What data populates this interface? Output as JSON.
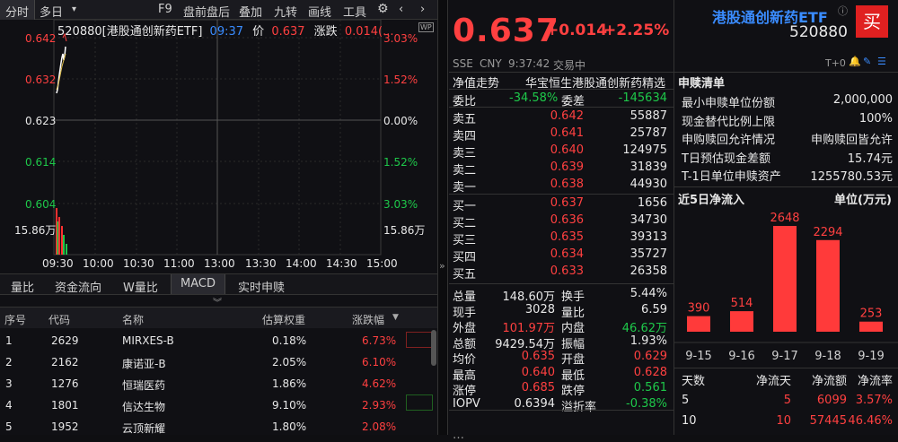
{
  "toolbar": {
    "tabs": [
      "分时",
      "多日"
    ],
    "dropdown": "▾",
    "items": [
      "F9",
      "盘前盘后",
      "叠加",
      "九转",
      "画线",
      "工具"
    ]
  },
  "chart": {
    "code_title": "520880[港股通创新药ETF]",
    "time": "09:37",
    "price_label": "价",
    "price": "0.637",
    "change_label": "涨跌",
    "change": "0.014(...",
    "y_left": [
      "0.642",
      "0.632",
      "0.623",
      "0.614",
      "0.604"
    ],
    "y_right": [
      "3.03%",
      "1.52%",
      "0.00%",
      "1.52%",
      "3.03%"
    ],
    "volume_left": "15.86万",
    "volume_right": "15.86万",
    "x_ticks": [
      "09:30",
      "10:00",
      "10:30",
      "11:00",
      "13:00",
      "13:30",
      "14:00",
      "14:30",
      "15:00"
    ]
  },
  "subtabs": [
    "量比",
    "资金流向",
    "W量比",
    "MACD",
    "实时申赎"
  ],
  "table": {
    "headers": [
      "序号",
      "代码",
      "名称",
      "估算权重",
      "涨跌幅"
    ],
    "rows": [
      {
        "idx": "1",
        "code": "2629",
        "name": "MIRXES-B",
        "weight": "0.18%",
        "chg": "6.73%"
      },
      {
        "idx": "2",
        "code": "2162",
        "name": "康诺亚-B",
        "weight": "2.05%",
        "chg": "6.10%"
      },
      {
        "idx": "3",
        "code": "1276",
        "name": "恒瑞医药",
        "weight": "1.86%",
        "chg": "4.62%"
      },
      {
        "idx": "4",
        "code": "1801",
        "name": "信达生物",
        "weight": "9.10%",
        "chg": "2.93%"
      },
      {
        "idx": "5",
        "code": "1952",
        "name": "云顶新耀",
        "weight": "1.80%",
        "chg": "2.08%"
      }
    ]
  },
  "quote": {
    "price": "0.637",
    "change": "+0.014",
    "pct": "+2.25%",
    "market": "SSE",
    "currency": "CNY",
    "time": "9:37:42",
    "status": "交易中",
    "name": "港股通创新药ETF",
    "code": "520880",
    "buy_btn": "买",
    "t0": "T+0"
  },
  "trend": {
    "label": "净值走势",
    "index_name": "华宝恒生港股通创新药精选"
  },
  "commission": {
    "ratio_label": "委比",
    "ratio": "-34.58%",
    "diff_label": "委差",
    "diff": "-145634"
  },
  "asks": [
    {
      "label": "卖五",
      "price": "0.642",
      "vol": "55887"
    },
    {
      "label": "卖四",
      "price": "0.641",
      "vol": "25787"
    },
    {
      "label": "卖三",
      "price": "0.640",
      "vol": "124975"
    },
    {
      "label": "卖二",
      "price": "0.639",
      "vol": "31839"
    },
    {
      "label": "卖一",
      "price": "0.638",
      "vol": "44930"
    }
  ],
  "bids": [
    {
      "label": "买一",
      "price": "0.637",
      "vol": "1656"
    },
    {
      "label": "买二",
      "price": "0.636",
      "vol": "34730"
    },
    {
      "label": "买三",
      "price": "0.635",
      "vol": "39313"
    },
    {
      "label": "买四",
      "price": "0.634",
      "vol": "35727"
    },
    {
      "label": "买五",
      "price": "0.633",
      "vol": "26358"
    }
  ],
  "stats": [
    [
      {
        "l": "总量",
        "v": "148.60万",
        "c": "white"
      },
      {
        "l": "换手",
        "v": "5.44%",
        "c": "white"
      }
    ],
    [
      {
        "l": "现手",
        "v": "3028",
        "c": "white"
      },
      {
        "l": "量比",
        "v": "6.59",
        "c": "white"
      }
    ],
    [
      {
        "l": "外盘",
        "v": "101.97万",
        "c": "red"
      },
      {
        "l": "内盘",
        "v": "46.62万",
        "c": "green"
      }
    ],
    [
      {
        "l": "总额",
        "v": "9429.54万",
        "c": "white"
      },
      {
        "l": "振幅",
        "v": "1.93%",
        "c": "white"
      }
    ],
    [
      {
        "l": "均价",
        "v": "0.635",
        "c": "red"
      },
      {
        "l": "开盘",
        "v": "0.629",
        "c": "red"
      }
    ],
    [
      {
        "l": "最高",
        "v": "0.640",
        "c": "red"
      },
      {
        "l": "最低",
        "v": "0.628",
        "c": "red"
      }
    ],
    [
      {
        "l": "涨停",
        "v": "0.685",
        "c": "red"
      },
      {
        "l": "跌停",
        "v": "0.561",
        "c": "green"
      }
    ],
    [
      {
        "l": "IOPV",
        "v": "0.6394",
        "c": "white"
      },
      {
        "l": "溢折率",
        "v": "-0.38%",
        "c": "green"
      }
    ]
  ],
  "subscription": {
    "title": "申赎清单",
    "items": [
      {
        "l": "最小申赎单位份额",
        "v": "2,000,000"
      },
      {
        "l": "现金替代比例上限",
        "v": "100%"
      },
      {
        "l": "申购赎回允许情况",
        "v": "申购赎回皆允许"
      },
      {
        "l": "T日预估现金差额",
        "v": "15.74元"
      },
      {
        "l": "T-1日单位申赎资产",
        "v": "1255780.53元"
      }
    ]
  },
  "inflow": {
    "title": "近5日净流入",
    "unit": "单位(万元)",
    "chart_data": {
      "type": "bar",
      "categories": [
        "9-15",
        "9-16",
        "9-17",
        "9-18",
        "9-19"
      ],
      "values": [
        390,
        514,
        2648,
        2294,
        253
      ],
      "ylim": [
        0,
        2648
      ]
    },
    "table_headers": [
      "天数",
      "净流天",
      "净流额",
      "净流率"
    ],
    "table_rows": [
      [
        "5",
        "5",
        "6099",
        "3.57%"
      ],
      [
        "10",
        "10",
        "57445",
        "46.46%"
      ]
    ]
  }
}
